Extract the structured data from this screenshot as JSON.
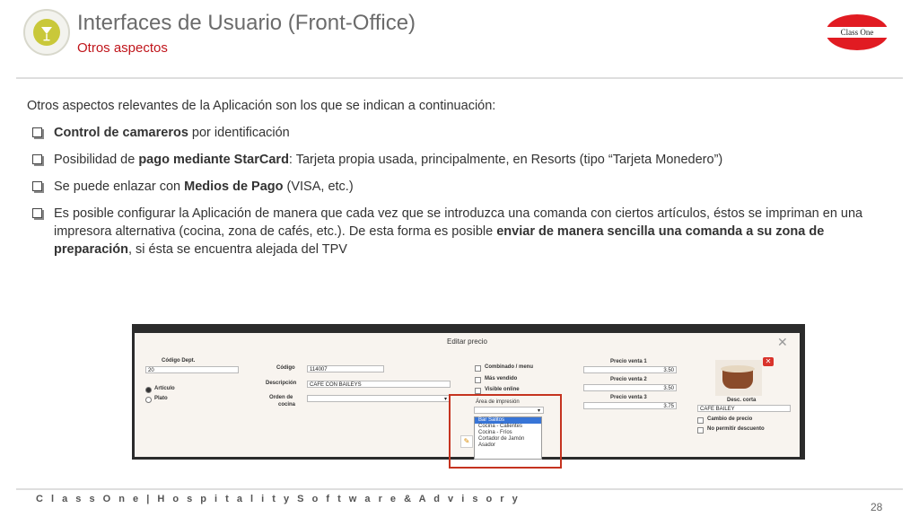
{
  "header": {
    "title": "Interfaces de Usuario (Front-Office)",
    "subtitle": "Otros aspectos",
    "brand": "Class One"
  },
  "body": {
    "intro": "Otros aspectos relevantes de la Aplicación son los que se indican a continuación:",
    "bullets": [
      {
        "bold": "Control de camareros",
        "text": " por identificación"
      },
      {
        "pre": "Posibilidad de ",
        "bold": "pago mediante StarCard",
        "text": ": Tarjeta propia usada, principalmente, en Resorts (tipo “Tarjeta Monedero”)"
      },
      {
        "pre": "Se puede enlazar con ",
        "bold": "Medios de Pago",
        "text": " (VISA, etc.)"
      },
      {
        "pre": "Es posible configurar la Aplicación de manera que cada vez que se introduzca una comanda con ciertos artículos, éstos se impriman en una impresora alternativa (cocina, zona de cafés, etc.). De esta forma es posible ",
        "bold": "enviar de manera sencilla una comanda a su zona de preparación",
        "text": ", si ésta se encuentra alejada del TPV"
      }
    ]
  },
  "dialog": {
    "title": "Editar precio",
    "codigo_dept_label": "Código Dept.",
    "codigo_dept_value": "20",
    "articulo_label": "Artículo",
    "plato_label": "Plato",
    "codigo_label": "Código",
    "codigo_value": "114007",
    "descripcion_label": "Descripción",
    "descripcion_value": "CAFE CON BAILEYS",
    "orden_label": "Orden de",
    "cocina_label": "cocina",
    "combinado_label": "Combinado / menu",
    "mas_vendido_label": "Más vendido",
    "visible_online_label": "Visible online",
    "area_impresion_label": "Área de impresión",
    "printer_options": [
      "Bar Salitos",
      "Cocina - Calientes",
      "Cocina - Fríos",
      "Cortador de Jamón",
      "Asador"
    ],
    "precio1_label": "Precio venta 1",
    "precio1_value": "3.50",
    "precio2_label": "Precio venta 2",
    "precio2_value": "3.50",
    "precio3_label": "Precio venta 3",
    "precio3_value": "3.75",
    "desc_corta_label": "Desc. corta",
    "desc_corta_value": "CAFE BAILEY",
    "cambio_precio_label": "Cambio de precio",
    "no_descuento_label": "No permitir descuento",
    "close_glyph": "✕",
    "remove_glyph": "✕",
    "select_arrow": "▾"
  },
  "footer": {
    "company": "C l a s s O n e | H o s p i t a l i t y S o f t w a r e & A d v i s o r y",
    "page": "28"
  },
  "colors": {
    "accent": "#c0151b",
    "brand": "#e11b22",
    "highlight": "#c5331f",
    "selection": "#3875d7"
  }
}
